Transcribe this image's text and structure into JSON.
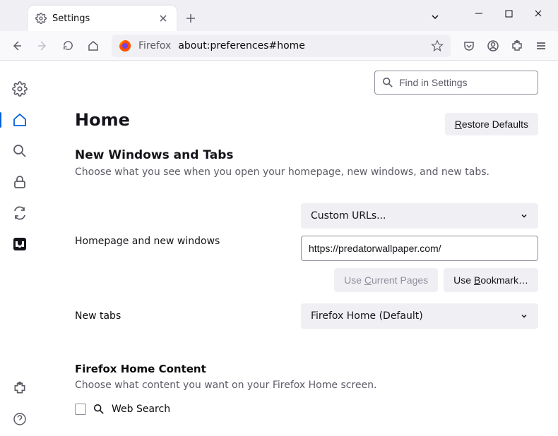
{
  "tab": {
    "title": "Settings"
  },
  "urlbar": {
    "brand": "Firefox",
    "url": "about:preferences#home"
  },
  "find": {
    "placeholder": "Find in Settings"
  },
  "page": {
    "title": "Home",
    "restore_label_pre": "R",
    "restore_label_post": "estore Defaults"
  },
  "section_new_windows": {
    "title": "New Windows and Tabs",
    "subtitle": "Choose what you see when you open your homepage, new windows, and new tabs."
  },
  "homepage": {
    "label": "Homepage and new windows",
    "select_value": "Custom URLs...",
    "input_value": "https://predatorwallpaper.com/",
    "use_current_pre": "Use ",
    "use_current_u": "C",
    "use_current_post": "urrent Pages",
    "use_bookmark_pre": "Use ",
    "use_bookmark_u": "B",
    "use_bookmark_post": "ookmark…"
  },
  "newtabs": {
    "label": "New tabs",
    "select_value": "Firefox Home (Default)"
  },
  "home_content": {
    "title": "Firefox Home Content",
    "subtitle": "Choose what content you want on your Firefox Home screen.",
    "web_search": "Web Search"
  }
}
